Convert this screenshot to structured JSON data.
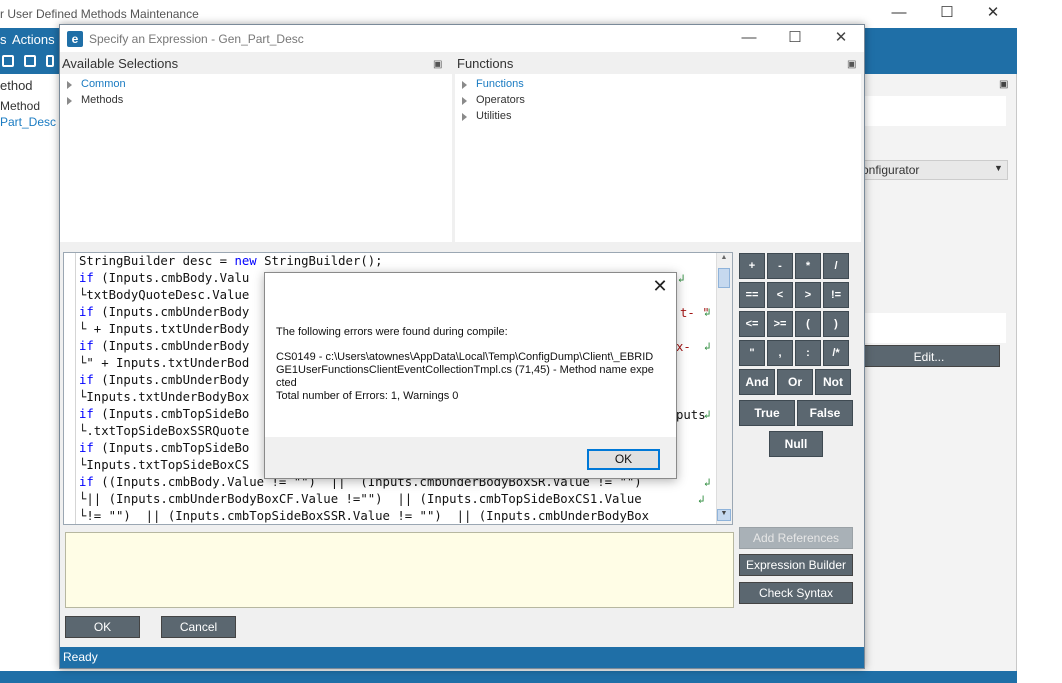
{
  "background": {
    "title": "r User Defined Methods Maintenance",
    "menu_actions": "Actions",
    "menu_partial": "s",
    "tree_header": "ethod",
    "tree_item": "Method",
    "tree_selected": "Part_Desc",
    "combo_value": "onfigurator",
    "edit_button": "Edit..."
  },
  "dialog": {
    "logo": "e",
    "title": "Specify an Expression - Gen_Part_Desc",
    "available": {
      "header": "Available Selections",
      "items": [
        "Common",
        "Methods"
      ]
    },
    "functions": {
      "header": "Functions",
      "items": [
        "Functions",
        "Operators",
        "Utilities"
      ]
    },
    "code_lines": [
      "StringBuilder desc = new StringBuilder();",
      "if (Inputs.cmbBody.Valu",
      "└txtBodyQuoteDesc.Value",
      "if (Inputs.cmbUnderBody",
      "└ + Inputs.txtUnderBody",
      "if (Inputs.cmbUnderBody",
      "└\" + Inputs.txtUnderBod",
      "if (Inputs.cmbUnderBody",
      "└Inputs.txtUnderBodyBox",
      "if (Inputs.cmbTopSideBo",
      "└.txtTopSideBoxSSRQuote",
      "if (Inputs.cmbTopSideBo",
      "└Inputs.txtTopSideBoxCS",
      "if ((Inputs.cmbBody.Value != \"\")  ||  (Inputs.cmbUnderBodyBoxSR.Value != \"\")",
      "└|| (Inputs.cmbUnderBodyBoxCF.Value !=\"\")  || (Inputs.cmbTopSideBoxCS1.Value",
      "└!= \"\")  || (Inputs.cmbTopSideBoxSSR.Value != \"\")  || (Inputs.cmbUnderBodyBox"
    ],
    "code_tail_fragments": [
      "t- \"",
      "x-",
      "puts"
    ],
    "operators": {
      "row1": [
        "+",
        "-",
        "*",
        "/"
      ],
      "row2": [
        "==",
        "<",
        ">",
        "!="
      ],
      "row3": [
        "<=",
        ">=",
        "(",
        ")"
      ],
      "row4": [
        "\"",
        ",",
        ":",
        "/*"
      ],
      "row5": [
        "And",
        "Or",
        "Not"
      ],
      "row6": [
        "True",
        "False"
      ],
      "row7": [
        "Null"
      ]
    },
    "add_references": "Add References",
    "expression_builder": "Expression Builder",
    "check_syntax": "Check Syntax",
    "ok": "OK",
    "cancel": "Cancel",
    "status": "Ready"
  },
  "message_box": {
    "line1": "The following errors were found during compile:",
    "detail": "CS0149 - c:\\Users\\atownes\\AppData\\Local\\Temp\\ConfigDump\\Client\\_EBRIDGE1UserFunctionsClientEventCollectionTmpl.cs (71,45) - Method name expected",
    "summary": "Total number of Errors: 1, Warnings 0",
    "ok": "OK"
  },
  "colors": {
    "accent_blue": "#1f6fa7",
    "button_gray": "#5b6770",
    "output_bg": "#fffde6",
    "keyword": "#0000ff"
  }
}
